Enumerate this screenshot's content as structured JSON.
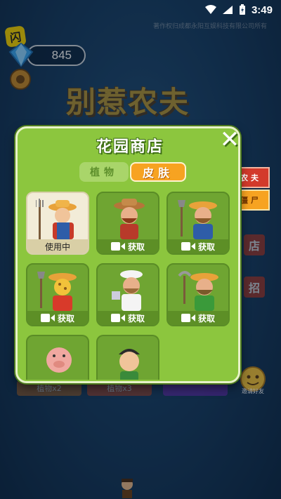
{
  "status_bar": {
    "time": "3:49"
  },
  "background": {
    "flash_badge": "闪",
    "gem_count": "845",
    "game_title": "别惹农夫",
    "copyright": "著作权归成都永阳互娱科技有限公司所有",
    "bottom_tabs": [
      "植物x2",
      "植物x3",
      ""
    ],
    "invite_label": "邀请好友",
    "side_buttons": [
      "店",
      "招"
    ]
  },
  "shop": {
    "title": "花园商店",
    "close": "✕",
    "tabs": [
      {
        "label": "植物",
        "active": false
      },
      {
        "label": "皮肤",
        "active": true
      }
    ],
    "skins": [
      {
        "label": "使用中",
        "status": "in-use"
      },
      {
        "label": "获取",
        "status": "video"
      },
      {
        "label": "获取",
        "status": "video"
      },
      {
        "label": "获取",
        "status": "video"
      },
      {
        "label": "获取",
        "status": "video"
      },
      {
        "label": "获取",
        "status": "video"
      },
      {
        "label": "",
        "status": "partial"
      },
      {
        "label": "",
        "status": "partial"
      }
    ]
  },
  "side_tabs": [
    {
      "label": "农夫",
      "color": "#d33a2b"
    },
    {
      "label": "僵尸",
      "color": "#f7a321"
    }
  ],
  "colors": {
    "panel_green": "#8cc63e",
    "accent_orange": "#f7a321"
  }
}
